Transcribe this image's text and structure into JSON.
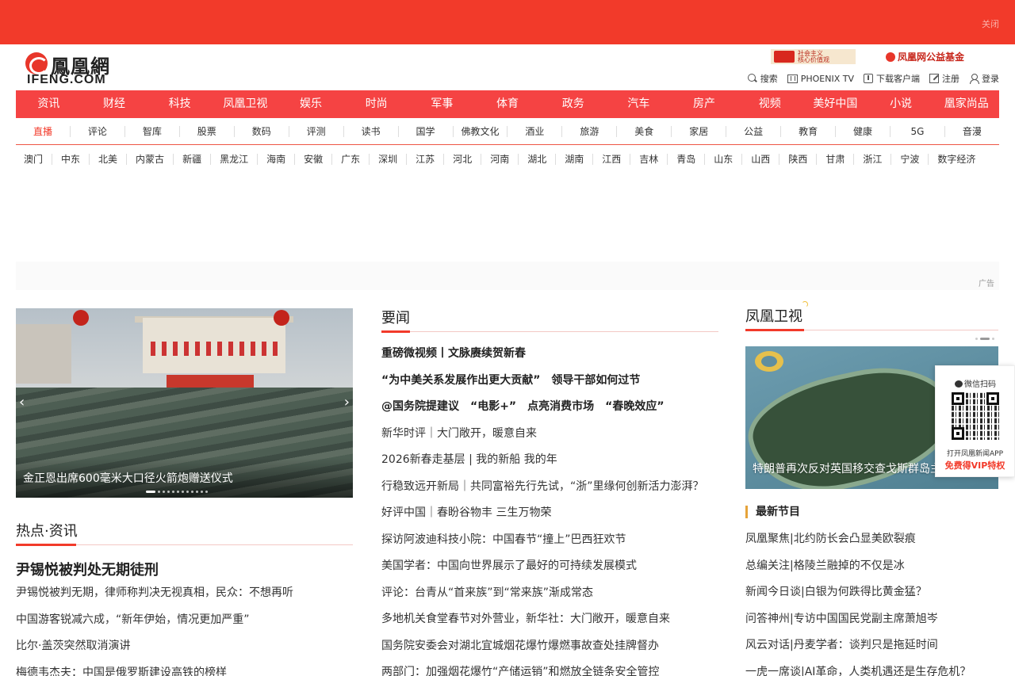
{
  "topbar": {
    "close_label": "关闭"
  },
  "header": {
    "logo_cn": "鳳凰網",
    "logo_en": "IFENG.COM",
    "promo1_text_a": "社会主义",
    "promo1_text_b": "核心价值观",
    "promo2_text": "凤凰网公益基金",
    "tools": {
      "search": "搜索",
      "phoenix_tv": "PHOENIX TV",
      "download": "下载客户端",
      "register": "注册",
      "login": "登录"
    }
  },
  "main_nav": [
    "资讯",
    "财经",
    "科技",
    "凤凰卫视",
    "娱乐",
    "时尚",
    "军事",
    "体育",
    "政务",
    "汽车",
    "房产",
    "视频",
    "美好中国",
    "小说",
    "凰家尚品"
  ],
  "sub_nav": [
    "直播",
    "评论",
    "智库",
    "股票",
    "数码",
    "评测",
    "读书",
    "国学",
    "佛教文化",
    "酒业",
    "旅游",
    "美食",
    "家居",
    "公益",
    "教育",
    "健康",
    "5G",
    "音漫"
  ],
  "region_nav": [
    "澳门",
    "中东",
    "北美",
    "内蒙古",
    "新疆",
    "黑龙江",
    "海南",
    "安徽",
    "广东",
    "深圳",
    "江苏",
    "河北",
    "河南",
    "湖北",
    "湖南",
    "江西",
    "吉林",
    "青岛",
    "山东",
    "山西",
    "陕西",
    "甘肃",
    "浙江",
    "宁波",
    "数字经济"
  ],
  "ad": {
    "label": "广告"
  },
  "slider": {
    "caption": "金正恩出席600毫米大口径火箭炮赠送仪式",
    "prev": "‹",
    "next": "›"
  },
  "hot": {
    "title": "热点·资讯",
    "lead": "尹锡悦被判处无期徒刑",
    "items": [
      "尹锡悦被判无期，律师称判决无视真相，民众：不想再听",
      "中国游客锐减六成，“新年伊始，情况更加严重”",
      "比尔·盖茨突然取消演讲",
      "梅德韦杰夫：中国是俄罗斯建设高铁的榜样"
    ]
  },
  "news": {
    "title": "要闻",
    "items": [
      {
        "text": "重磅微视频丨文脉赓续贺新春",
        "bold": true
      },
      {
        "text": "“为中美关系发展作出更大贡献”　领导干部如何过节",
        "bold": true
      },
      {
        "text": "@国务院提建议　“电影+”　点亮消费市场　“春晚效应”",
        "bold": true
      },
      {
        "text": "新华时评｜大门敞开，暖意自来",
        "bold": false
      },
      {
        "text": "2026新春走基层 | 我的新船 我的年",
        "bold": false
      },
      {
        "text": "行稳致远开新局｜共同富裕先行先试，“浙”里缘何创新活力澎湃？",
        "bold": false
      },
      {
        "text": "好评中国｜春盼谷物丰 三生万物荣",
        "bold": false
      },
      {
        "text": "探访阿波迪科技小院：中国春节“撞上”巴西狂欢节",
        "bold": false
      },
      {
        "text": "美国学者：中国向世界展示了最好的可持续发展模式",
        "bold": false
      },
      {
        "text": "评论：台青从“首来族”到“常来族”渐成常态",
        "bold": false
      },
      {
        "text": "多地机关食堂春节对外营业，新华社：大门敞开，暖意自来",
        "bold": false
      },
      {
        "text": "国务院安委会对湖北宜城烟花爆竹爆燃事故查处挂牌督办",
        "bold": false
      },
      {
        "text": "两部门：加强烟花爆竹“产储运销”和燃放全链条安全管控",
        "bold": false
      }
    ]
  },
  "tv": {
    "title": "凤凰卫视",
    "caption": "特朗普再次反对英国移交查戈斯群岛主权",
    "programs_title": "最新节目",
    "programs": [
      "凤凰聚焦|北约防长会凸显美欧裂痕",
      "总编关注|格陵兰融掉的不仅是冰",
      "新闻今日谈|白银为何跌得比黄金猛？",
      "问答神州|专访中国国民党副主席萧旭岑",
      "风云对话|丹麦学者：谈判只是拖延时间",
      "一虎一席谈|AI革命，人类机遇还是生存危机？"
    ]
  },
  "qr": {
    "head": "微信扫码",
    "line1": "打开凤凰新闻APP",
    "line2": "免费得VIP特权"
  },
  "colors": {
    "brand_red": "#f23a2a",
    "nav_red": "#f54343"
  }
}
